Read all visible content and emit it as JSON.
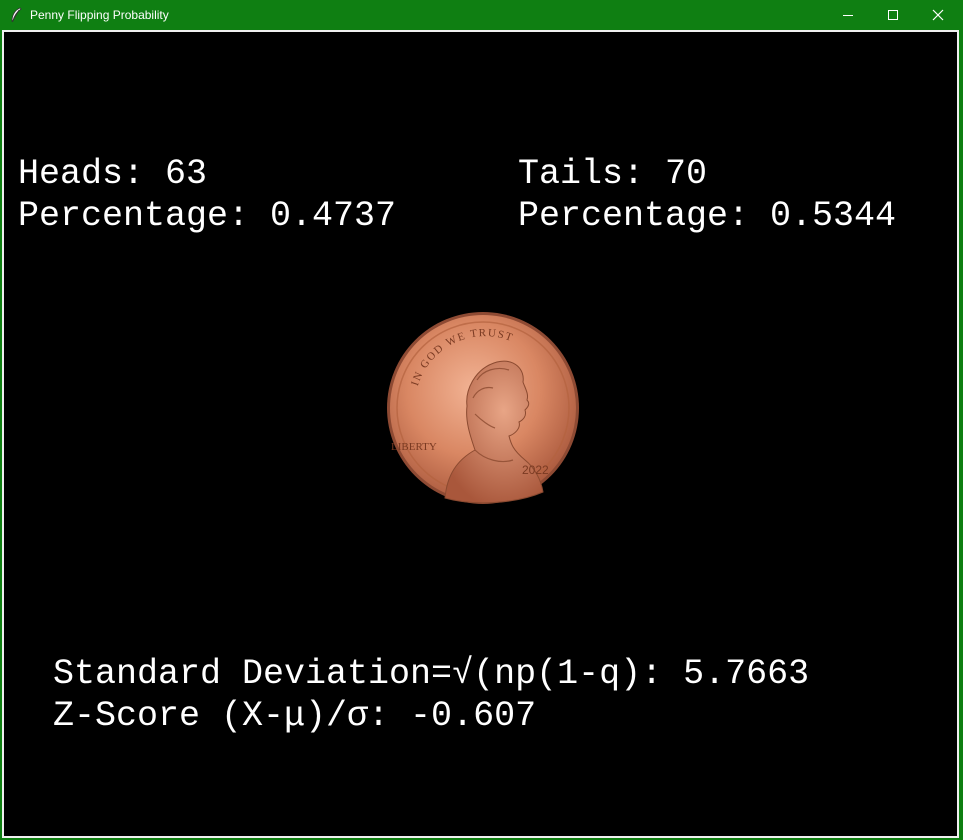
{
  "window": {
    "title": "Penny Flipping Probability",
    "titlebar_color": "#0f7f12",
    "background": "#000000",
    "text_color": "#ffffff"
  },
  "heads": {
    "count_text": "Heads: 63",
    "percentage_text": "Percentage: 0.4737"
  },
  "tails": {
    "count_text": "Tails: 70",
    "percentage_text": "Percentage: 0.5344"
  },
  "coin": {
    "motto": "IN GOD WE TRUST",
    "liberty": "LIBERTY",
    "year": "2022",
    "color": "#d07a56"
  },
  "stats": {
    "std_dev_text": "Standard Deviation=√(np(1-q): 5.7663",
    "z_score_text": "Z-Score (X-μ)/σ: -0.607"
  },
  "icons": {
    "app": "feather-icon",
    "minimize": "minimize-icon",
    "maximize": "maximize-icon",
    "close": "close-icon"
  }
}
